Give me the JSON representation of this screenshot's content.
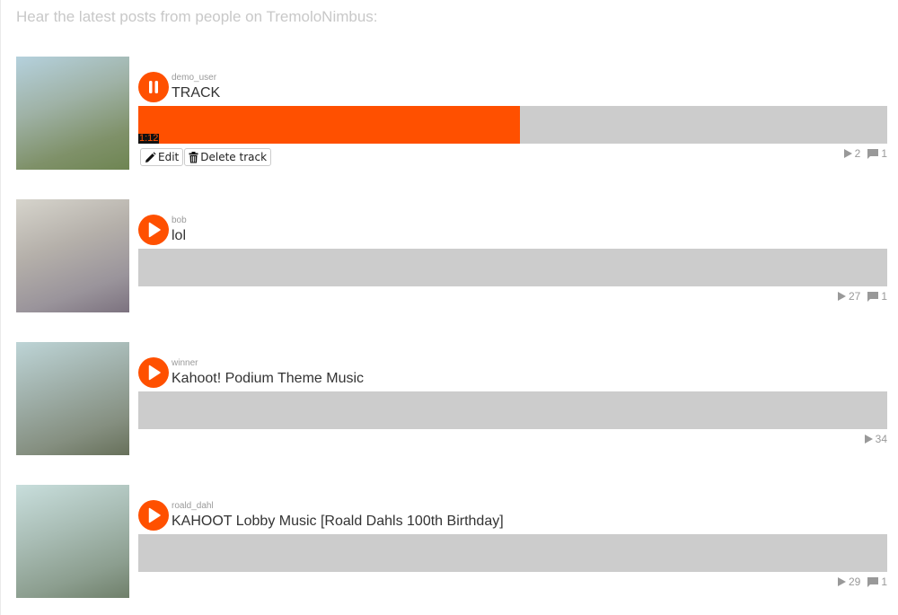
{
  "header": {
    "intro_text": "Hear the latest posts from people on TremoloNimbus:"
  },
  "colors": {
    "accent": "#ff5000",
    "waveform_bg": "#cccccc",
    "muted_text": "#c8c8c8"
  },
  "tracks": [
    {
      "user": "demo_user",
      "title": "TRACK",
      "state": "playing",
      "button_icon": "pause-icon",
      "progress_fraction": 0.51,
      "time": "1:12",
      "plays": "2",
      "comments": "1",
      "actions": {
        "edit_label": "Edit",
        "delete_label": "Delete track"
      }
    },
    {
      "user": "bob",
      "title": "lol",
      "state": "stopped",
      "button_icon": "play-icon",
      "plays": "27",
      "comments": "1"
    },
    {
      "user": "winner",
      "title": "Kahoot! Podium Theme Music",
      "state": "stopped",
      "button_icon": "play-icon",
      "plays": "34"
    },
    {
      "user": "roald_dahl",
      "title": "KAHOOT Lobby Music [Roald Dahls 100th Birthday]",
      "state": "stopped",
      "button_icon": "play-icon",
      "plays": "29",
      "comments": "1"
    }
  ]
}
